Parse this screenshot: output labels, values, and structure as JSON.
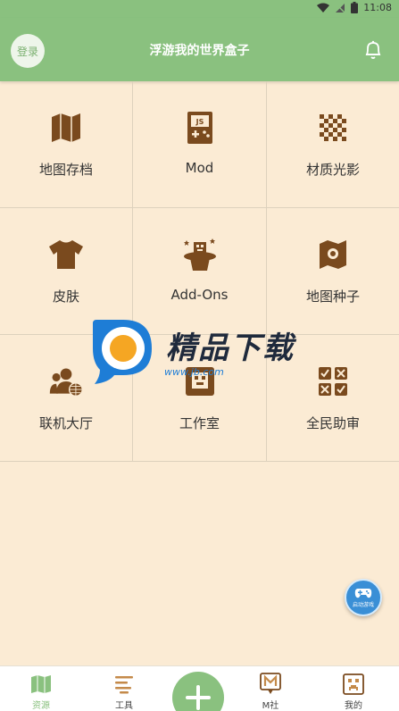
{
  "status_bar": {
    "time": "11:08"
  },
  "header": {
    "login_label": "登录",
    "title": "浮游我的世界盒子"
  },
  "grid": {
    "items": [
      {
        "label": "地图存档",
        "icon": "map-icon"
      },
      {
        "label": "Mod",
        "icon": "js-gamepad-icon"
      },
      {
        "label": "材质光影",
        "icon": "checker-texture-icon"
      },
      {
        "label": "皮肤",
        "icon": "shirt-icon"
      },
      {
        "label": "Add-Ons",
        "icon": "magic-hat-icon"
      },
      {
        "label": "地图种子",
        "icon": "map-seed-icon"
      },
      {
        "label": "联机大厅",
        "icon": "multiplayer-icon"
      },
      {
        "label": "工作室",
        "icon": "studio-icon"
      },
      {
        "label": "全民助审",
        "icon": "review-icon"
      }
    ]
  },
  "watermark": {
    "text": "精品下载",
    "url": "www.jb.com"
  },
  "float_button": {
    "label": "启动游戏"
  },
  "tabs": [
    {
      "label": "资源",
      "icon": "map-icon",
      "active": true
    },
    {
      "label": "工具",
      "icon": "tools-icon",
      "active": false
    },
    {
      "label": "M社",
      "icon": "community-icon",
      "active": false
    },
    {
      "label": "我的",
      "icon": "profile-icon",
      "active": false
    }
  ],
  "colors": {
    "accent": "#8ac17f",
    "icon_brown": "#7a4a1e",
    "background": "#fbebd4"
  }
}
